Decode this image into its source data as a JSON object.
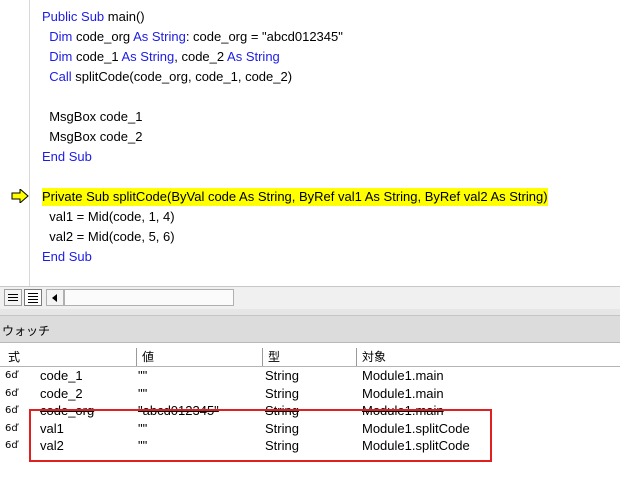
{
  "editor": {
    "lines": [
      {
        "id": "l1",
        "parts": [
          {
            "t": "Public Sub",
            "kw": true
          },
          {
            "t": " main()",
            "kw": false
          }
        ]
      },
      {
        "id": "l2",
        "parts": [
          {
            "t": "  Dim",
            "kw": true
          },
          {
            "t": " code_org ",
            "kw": false
          },
          {
            "t": "As String",
            "kw": true
          },
          {
            "t": ": code_org = \"abcd012345\"",
            "kw": false
          }
        ]
      },
      {
        "id": "l3",
        "parts": [
          {
            "t": "  Dim",
            "kw": true
          },
          {
            "t": " code_1 ",
            "kw": false
          },
          {
            "t": "As String",
            "kw": true
          },
          {
            "t": ", code_2 ",
            "kw": false
          },
          {
            "t": "As String",
            "kw": true
          }
        ]
      },
      {
        "id": "l4",
        "parts": [
          {
            "t": "  Call",
            "kw": true
          },
          {
            "t": " splitCode(code_org, code_1, code_2)",
            "kw": false
          }
        ]
      },
      {
        "id": "l5",
        "parts": []
      },
      {
        "id": "l6",
        "parts": [
          {
            "t": "  MsgBox code_1",
            "kw": false
          }
        ]
      },
      {
        "id": "l7",
        "parts": [
          {
            "t": "  MsgBox code_2",
            "kw": false
          }
        ]
      },
      {
        "id": "l8",
        "parts": [
          {
            "t": "End Sub",
            "kw": true
          }
        ]
      },
      {
        "id": "l9",
        "parts": []
      },
      {
        "id": "l10",
        "parts": [
          {
            "t": "Private Sub splitCode(ByVal code As String, ByRef val1 As String, ByRef val2 As String)",
            "kw": false
          }
        ],
        "highlight": true
      },
      {
        "id": "l11",
        "parts": [
          {
            "t": "  val1 = Mid(code, 1, 4)",
            "kw": false
          }
        ]
      },
      {
        "id": "l12",
        "parts": [
          {
            "t": "  val2 = Mid(code, 5, 6)",
            "kw": false
          }
        ]
      },
      {
        "id": "l13",
        "parts": [
          {
            "t": "End Sub",
            "kw": true
          }
        ]
      }
    ],
    "colors": {
      "keyword": "#1c1ce6",
      "highlight": "#ffff00",
      "arrow": "#ffff00"
    }
  },
  "watch": {
    "title": "ウォッチ",
    "columns": {
      "expr": "式",
      "value": "値",
      "type": "型",
      "context": "対象"
    },
    "rows": [
      {
        "expr": "code_1",
        "value": "\"\"",
        "type": "String",
        "context": "Module1.main",
        "strike": false
      },
      {
        "expr": "code_2",
        "value": "\"\"",
        "type": "String",
        "context": "Module1.main",
        "strike": false
      },
      {
        "expr": "code_org",
        "value": "\"abcd012345\"",
        "type": "String",
        "context": "Module1.main",
        "strike": true
      },
      {
        "expr": "val1",
        "value": "\"\"",
        "type": "String",
        "context": "Module1.splitCode",
        "strike": false
      },
      {
        "expr": "val2",
        "value": "\"\"",
        "type": "String",
        "context": "Module1.splitCode",
        "strike": false
      }
    ],
    "row_icon": "glasses-icon",
    "highlight_color": "#e02020"
  }
}
